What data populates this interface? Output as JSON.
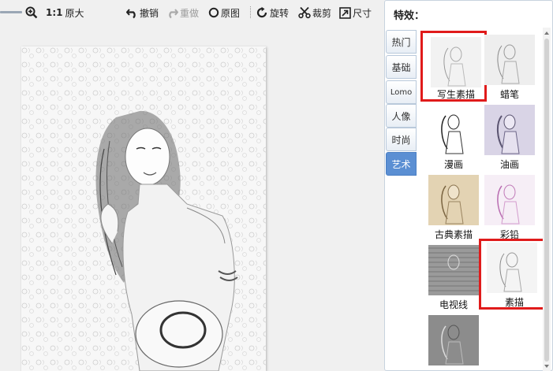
{
  "toolbar": {
    "ratio": "1:1",
    "original_size": "原大",
    "undo": "撤销",
    "redo": "重做",
    "original_image": "原图",
    "rotate": "旋转",
    "crop": "裁剪",
    "size": "尺寸"
  },
  "panel": {
    "title": "特效：",
    "categories": [
      {
        "label": "热门"
      },
      {
        "label": "基础"
      },
      {
        "label": "Lomo"
      },
      {
        "label": "人像"
      },
      {
        "label": "时尚"
      },
      {
        "label": "艺术"
      }
    ],
    "active_category": "艺术",
    "effects": [
      {
        "label": "写生素描",
        "selected": true
      },
      {
        "label": "蜡笔",
        "selected": false
      },
      {
        "label": "漫画",
        "selected": false
      },
      {
        "label": "油画",
        "selected": false
      },
      {
        "label": "古典素描",
        "selected": false
      },
      {
        "label": "彩铅",
        "selected": false
      },
      {
        "label": "电视线",
        "selected": false
      },
      {
        "label": "素描",
        "selected": true
      },
      {
        "label": "",
        "selected": false
      }
    ]
  },
  "colors": {
    "accent_tab": "#5b8fd3",
    "selection": "#e01b1b",
    "panel_border": "#c8d3df"
  }
}
